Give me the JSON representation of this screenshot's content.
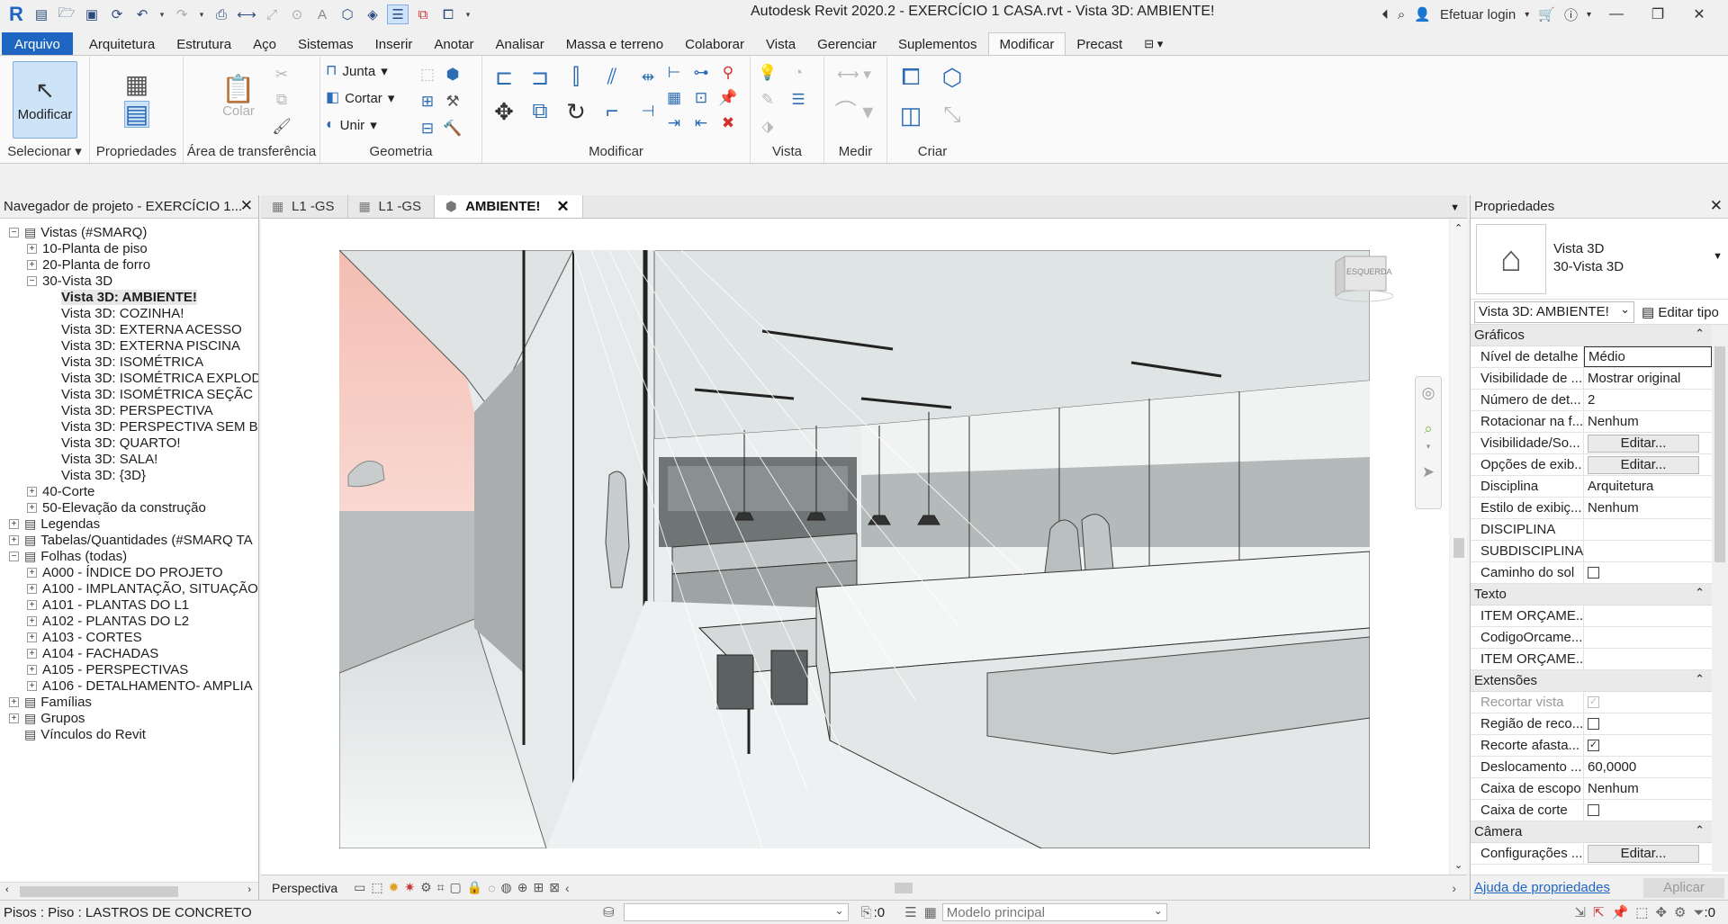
{
  "window": {
    "title": "Autodesk Revit 2020.2 - EXERCÍCIO 1 CASA.rvt - Vista 3D: AMBIENTE!",
    "login": "Efetuar login"
  },
  "menu": [
    "Arquivo",
    "Arquitetura",
    "Estrutura",
    "Aço",
    "Sistemas",
    "Inserir",
    "Anotar",
    "Analisar",
    "Massa e terreno",
    "Colaborar",
    "Vista",
    "Gerenciar",
    "Suplementos",
    "Modificar",
    "Precast"
  ],
  "ribbon": {
    "modify_button": "Modificar",
    "paste_label": "Colar",
    "geometry": {
      "join": "Junta",
      "cut": "Cortar",
      "unite": "Unir"
    },
    "panels": {
      "select": "Selecionar",
      "properties": "Propriedades",
      "clipboard": "Área de transferência",
      "geometry": "Geometria",
      "modify": "Modificar",
      "view": "Vista",
      "measure": "Medir",
      "create": "Criar"
    }
  },
  "project_browser": {
    "title": "Navegador de projeto - EXERCÍCIO 1...",
    "items": [
      {
        "label": "Vistas (#SMARQ)",
        "level": 0,
        "toggle": "−"
      },
      {
        "label": "10-Planta de piso",
        "level": 1,
        "toggle": "+"
      },
      {
        "label": "20-Planta de forro",
        "level": 1,
        "toggle": "+"
      },
      {
        "label": "30-Vista 3D",
        "level": 1,
        "toggle": "−"
      },
      {
        "label": "Vista 3D: AMBIENTE!",
        "level": 2,
        "selected": true
      },
      {
        "label": "Vista 3D: COZINHA!",
        "level": 2
      },
      {
        "label": "Vista 3D: EXTERNA ACESSO",
        "level": 2
      },
      {
        "label": "Vista 3D: EXTERNA PISCINA",
        "level": 2
      },
      {
        "label": "Vista 3D: ISOMÉTRICA",
        "level": 2
      },
      {
        "label": "Vista 3D: ISOMÉTRICA EXPLOD",
        "level": 2
      },
      {
        "label": "Vista 3D: ISOMÉTRICA SEÇÃC",
        "level": 2
      },
      {
        "label": "Vista 3D: PERSPECTIVA",
        "level": 2
      },
      {
        "label": "Vista 3D: PERSPECTIVA SEM B",
        "level": 2
      },
      {
        "label": "Vista 3D: QUARTO!",
        "level": 2
      },
      {
        "label": "Vista 3D: SALA!",
        "level": 2
      },
      {
        "label": "Vista 3D: {3D}",
        "level": 2
      },
      {
        "label": "40-Corte",
        "level": 1,
        "toggle": "+"
      },
      {
        "label": "50-Elevação da construção",
        "level": 1,
        "toggle": "+"
      },
      {
        "label": "Legendas",
        "level": 0,
        "toggle": "+"
      },
      {
        "label": "Tabelas/Quantidades (#SMARQ TA",
        "level": 0,
        "toggle": "+"
      },
      {
        "label": "Folhas (todas)",
        "level": 0,
        "toggle": "−"
      },
      {
        "label": "A000 - ÍNDICE DO PROJETO",
        "level": 1,
        "toggle": "+"
      },
      {
        "label": "A100 - IMPLANTAÇÃO, SITUAÇÃO",
        "level": 1,
        "toggle": "+"
      },
      {
        "label": "A101 - PLANTAS DO L1",
        "level": 1,
        "toggle": "+"
      },
      {
        "label": "A102 - PLANTAS DO L2",
        "level": 1,
        "toggle": "+"
      },
      {
        "label": "A103 - CORTES",
        "level": 1,
        "toggle": "+"
      },
      {
        "label": "A104 - FACHADAS",
        "level": 1,
        "toggle": "+"
      },
      {
        "label": "A105 - PERSPECTIVAS",
        "level": 1,
        "toggle": "+"
      },
      {
        "label": "A106 - DETALHAMENTO- AMPLIA",
        "level": 1,
        "toggle": "+"
      },
      {
        "label": "Famílias",
        "level": 0,
        "toggle": "+"
      },
      {
        "label": "Grupos",
        "level": 0,
        "toggle": "+"
      },
      {
        "label": "Vínculos do Revit",
        "level": 0
      }
    ]
  },
  "view_tabs": [
    {
      "label": "L1 -GS"
    },
    {
      "label": "L1 -GS"
    },
    {
      "label": "AMBIENTE!",
      "active": true
    }
  ],
  "viewcube": {
    "face": "ESQUERDA"
  },
  "view_controls": {
    "mode": "Perspectiva"
  },
  "properties": {
    "title": "Propriedades",
    "type_line1": "Vista 3D",
    "type_line2": "30-Vista 3D",
    "instance": "Vista 3D: AMBIENTE!",
    "edit_type": "Editar tipo",
    "sections": [
      {
        "name": "Gráficos",
        "rows": [
          {
            "key": "Nível de detalhe",
            "value": "Médio",
            "edit": true
          },
          {
            "key": "Visibilidade de ...",
            "value": "Mostrar original"
          },
          {
            "key": "Número de det...",
            "value": "2"
          },
          {
            "key": "Rotacionar na f...",
            "value": "Nenhum"
          },
          {
            "key": "Visibilidade/So...",
            "value": "Editar...",
            "button": true
          },
          {
            "key": "Opções de exib...",
            "value": "Editar...",
            "button": true
          },
          {
            "key": "Disciplina",
            "value": "Arquitetura"
          },
          {
            "key": "Estilo de exibiç...",
            "value": "Nenhum"
          },
          {
            "key": "DISCIPLINA",
            "value": ""
          },
          {
            "key": "SUBDISCIPLINA",
            "value": ""
          },
          {
            "key": "Caminho do sol",
            "check": false
          }
        ]
      },
      {
        "name": "Texto",
        "rows": [
          {
            "key": "ITEM ORÇAME...",
            "value": ""
          },
          {
            "key": "CodigoOrcame...",
            "value": ""
          },
          {
            "key": "ITEM ORÇAME...",
            "value": ""
          }
        ]
      },
      {
        "name": "Extensões",
        "rows": [
          {
            "key": "Recortar vista",
            "check": true,
            "disabled": true
          },
          {
            "key": "Região de reco...",
            "check": false
          },
          {
            "key": "Recorte afasta...",
            "check": true
          },
          {
            "key": "Deslocamento ...",
            "value": "60,0000"
          },
          {
            "key": "Caixa de escopo",
            "value": "Nenhum"
          },
          {
            "key": "Caixa de corte",
            "check": false
          }
        ]
      },
      {
        "name": "Câmera",
        "rows": [
          {
            "key": "Configurações ...",
            "value": "Editar...",
            "button": true
          }
        ]
      }
    ],
    "help_link": "Ajuda de propriedades",
    "apply": "Aplicar"
  },
  "status": {
    "text": "Pisos : Piso : LASTROS DE CONCRETO",
    "count": ":0",
    "model": "Modelo principal",
    "filter": ":0"
  }
}
